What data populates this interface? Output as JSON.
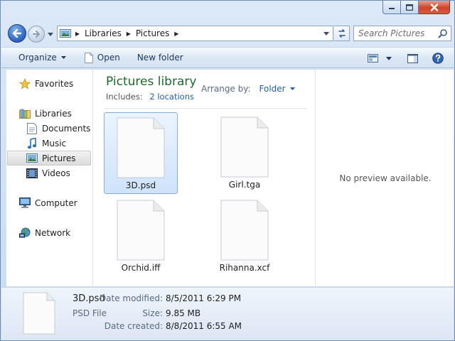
{
  "address": {
    "crumbs": [
      "Libraries",
      "Pictures"
    ]
  },
  "search": {
    "placeholder": "Search Pictures"
  },
  "toolbar": {
    "organize": "Organize",
    "open": "Open",
    "new_folder": "New folder"
  },
  "nav": {
    "favorites": "Favorites",
    "libraries": "Libraries",
    "documents": "Documents",
    "music": "Music",
    "pictures": "Pictures",
    "videos": "Videos",
    "computer": "Computer",
    "network": "Network"
  },
  "library": {
    "title": "Pictures library",
    "includes_label": "Includes:",
    "includes_link": "2 locations",
    "arrange_label": "Arrange by:",
    "arrange_value": "Folder"
  },
  "files": [
    {
      "name": "3D.psd",
      "selected": true
    },
    {
      "name": "Girl.tga",
      "selected": false
    },
    {
      "name": "Orchid.iff",
      "selected": false
    },
    {
      "name": "Rihanna.xcf",
      "selected": false
    }
  ],
  "preview": {
    "message": "No preview available."
  },
  "details": {
    "name": "3D.psd",
    "type": "PSD File",
    "modified_label": "Date modified:",
    "modified_value": "8/5/2011 6:29 PM",
    "size_label": "Size:",
    "size_value": "9.85 MB",
    "created_label": "Date created:",
    "created_value": "8/8/2011 6:55 AM"
  },
  "colors": {
    "accent": "#1f5fab",
    "library_title": "#1e6a2a",
    "selection": "#cfe3fb"
  }
}
